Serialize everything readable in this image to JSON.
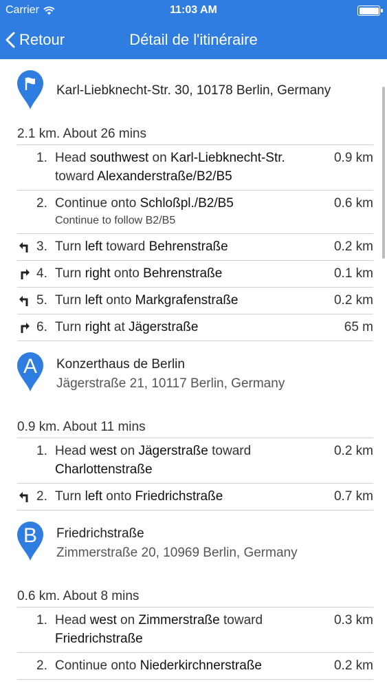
{
  "status": {
    "carrier": "Carrier",
    "time": "11:03 AM"
  },
  "nav": {
    "back_label": "Retour",
    "title": "Détail de l'itinéraire"
  },
  "colors": {
    "accent": "#2f7de1"
  },
  "sections": [
    {
      "waypoint": {
        "marker": "flag",
        "name": "Karl-Liebknecht-Str. 30, 10178 Berlin, Germany",
        "address": ""
      },
      "summary": "2.1 km. About 26 mins",
      "steps": [
        {
          "icon": "",
          "num": "1.",
          "text": [
            [
              "Head ",
              false
            ],
            [
              "southwest",
              true
            ],
            [
              " on ",
              false
            ],
            [
              "Karl-Liebknecht-Str.",
              true
            ],
            [
              " toward ",
              false
            ],
            [
              "Alexanderstraße/B2/B5",
              true
            ]
          ],
          "sub": "",
          "dist": "0.9 km"
        },
        {
          "icon": "",
          "num": "2.",
          "text": [
            [
              "Continue onto ",
              false
            ],
            [
              "Schloßpl./B2/B5",
              true
            ]
          ],
          "sub": "Continue to follow B2/B5",
          "dist": "0.6 km"
        },
        {
          "icon": "turn-left-icon",
          "num": "3.",
          "text": [
            [
              "Turn ",
              false
            ],
            [
              "left",
              true
            ],
            [
              " toward ",
              false
            ],
            [
              "Behrenstraße",
              true
            ]
          ],
          "sub": "",
          "dist": "0.2 km"
        },
        {
          "icon": "turn-right-icon",
          "num": "4.",
          "text": [
            [
              "Turn ",
              false
            ],
            [
              "right",
              true
            ],
            [
              " onto ",
              false
            ],
            [
              "Behrenstraße",
              true
            ]
          ],
          "sub": "",
          "dist": "0.1 km"
        },
        {
          "icon": "turn-left-icon",
          "num": "5.",
          "text": [
            [
              "Turn ",
              false
            ],
            [
              "left",
              true
            ],
            [
              " onto ",
              false
            ],
            [
              "Markgrafenstraße",
              true
            ]
          ],
          "sub": "",
          "dist": "0.2 km"
        },
        {
          "icon": "turn-right-icon",
          "num": "6.",
          "text": [
            [
              "Turn ",
              false
            ],
            [
              "right",
              true
            ],
            [
              " at ",
              false
            ],
            [
              "Jägerstraße",
              true
            ]
          ],
          "sub": "",
          "dist": "65 m"
        }
      ]
    },
    {
      "waypoint": {
        "marker": "A",
        "name": "Konzerthaus de Berlin",
        "address": "Jägerstraße 21, 10117 Berlin, Germany"
      },
      "summary": "0.9 km. About 11 mins",
      "steps": [
        {
          "icon": "",
          "num": "1.",
          "text": [
            [
              "Head ",
              false
            ],
            [
              "west",
              true
            ],
            [
              " on ",
              false
            ],
            [
              "Jägerstraße",
              true
            ],
            [
              " toward ",
              false
            ],
            [
              "Charlottenstraße",
              true
            ]
          ],
          "sub": "",
          "dist": "0.2 km"
        },
        {
          "icon": "turn-left-icon",
          "num": "2.",
          "text": [
            [
              "Turn ",
              false
            ],
            [
              "left",
              true
            ],
            [
              " onto ",
              false
            ],
            [
              "Friedrichstraße",
              true
            ]
          ],
          "sub": "",
          "dist": "0.7 km"
        }
      ]
    },
    {
      "waypoint": {
        "marker": "B",
        "name": "Friedrichstraße",
        "address": "Zimmerstraße 20, 10969 Berlin, Germany"
      },
      "summary": "0.6 km. About 8 mins",
      "steps": [
        {
          "icon": "",
          "num": "1.",
          "text": [
            [
              "Head ",
              false
            ],
            [
              "west",
              true
            ],
            [
              " on ",
              false
            ],
            [
              "Zimmerstraße",
              true
            ],
            [
              " toward ",
              false
            ],
            [
              "Friedrichstraße",
              true
            ]
          ],
          "sub": "",
          "dist": "0.3 km"
        },
        {
          "icon": "",
          "num": "2.",
          "text": [
            [
              "Continue onto ",
              false
            ],
            [
              "Niederkirchnerstraße",
              true
            ]
          ],
          "sub": "",
          "dist": "0.2 km"
        }
      ]
    }
  ]
}
